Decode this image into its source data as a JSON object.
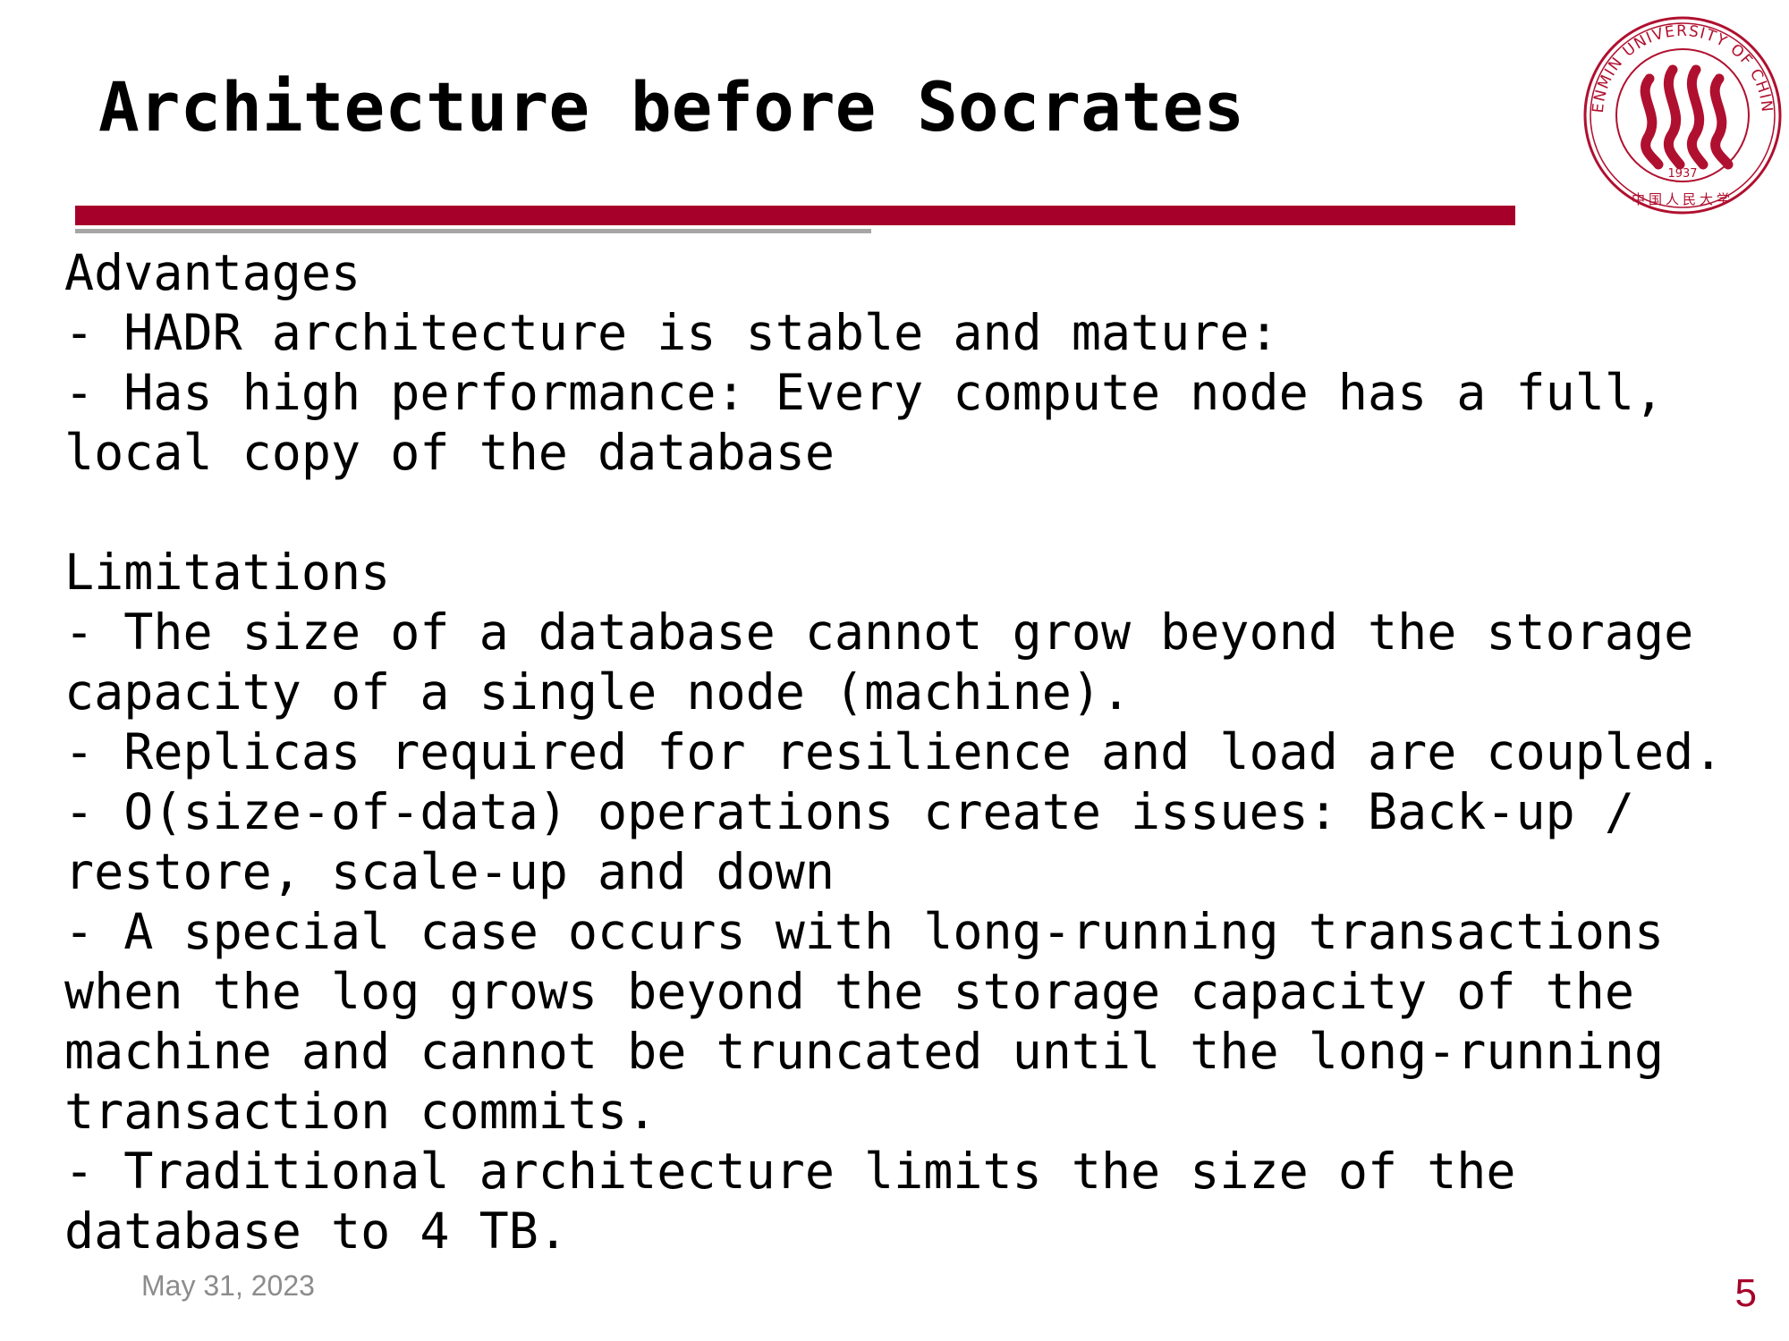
{
  "slide": {
    "title": "Architecture before Socrates",
    "advantages_heading": "Advantages",
    "advantages": [
      "- HADR architecture is stable and mature:",
      "- Has high performance: Every compute node has a full,",
      "local copy of the database"
    ],
    "limitations_heading": "Limitations",
    "limitations": [
      "- The size of a database cannot grow beyond the storage",
      "capacity of a single node (machine).",
      "- Replicas required for resilience and load are coupled.",
      "- O(size-of-data) operations create issues: Back-up /",
      "restore, scale-up and down",
      "- A special case occurs with long-running transactions",
      "when the log grows beyond the storage capacity of the",
      "machine and cannot be truncated until the long-running",
      "transaction commits.",
      "- Traditional architecture limits the size of the",
      "database to 4 TB."
    ]
  },
  "footer": {
    "date": "May 31, 2023",
    "page_number": "5"
  },
  "logo": {
    "ring_text": "RENMIN UNIVERSITY OF CHINA",
    "year": "1937",
    "chinese_name": "中国人民大学",
    "color": "#b0102f"
  },
  "colors": {
    "accent": "#a6002a",
    "rule_gray": "#a6a6a6",
    "footer_gray": "#8c8c8c"
  }
}
